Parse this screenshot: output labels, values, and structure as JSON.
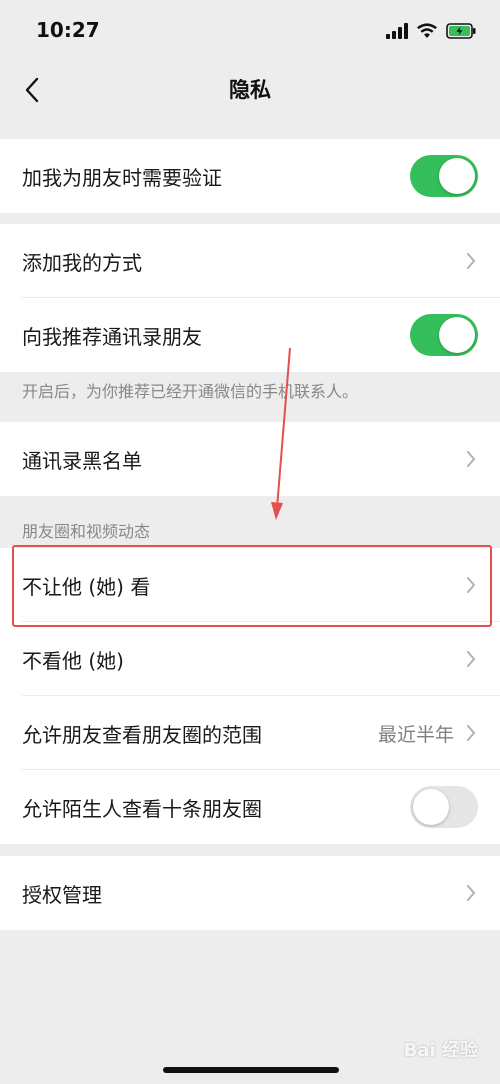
{
  "status": {
    "time": "10:27"
  },
  "nav": {
    "title": "隐私"
  },
  "groups": {
    "verify": {
      "label": "加我为朋友时需要验证",
      "toggle": true
    },
    "add": {
      "label": "添加我的方式"
    },
    "recommend": {
      "label": "向我推荐通讯录朋友",
      "toggle": true
    },
    "recommend_hint": "开启后，为你推荐已经开通微信的手机联系人。",
    "blacklist": {
      "label": "通讯录黑名单"
    },
    "moments_header": "朋友圈和视频动态",
    "dont_let_see": {
      "label": "不让他 (她) 看"
    },
    "dont_see": {
      "label": "不看他 (她)"
    },
    "moments_range": {
      "label": "允许朋友查看朋友圈的范围",
      "value": "最近半年"
    },
    "strangers": {
      "label": "允许陌生人查看十条朋友圈",
      "toggle": false
    },
    "authorization": {
      "label": "授权管理"
    }
  },
  "watermark": "Bai 经验",
  "colors": {
    "toggle_on": "#35bf5b",
    "toggle_off": "#e5e5e5",
    "highlight": "#e3504f",
    "background": "#ededed"
  }
}
